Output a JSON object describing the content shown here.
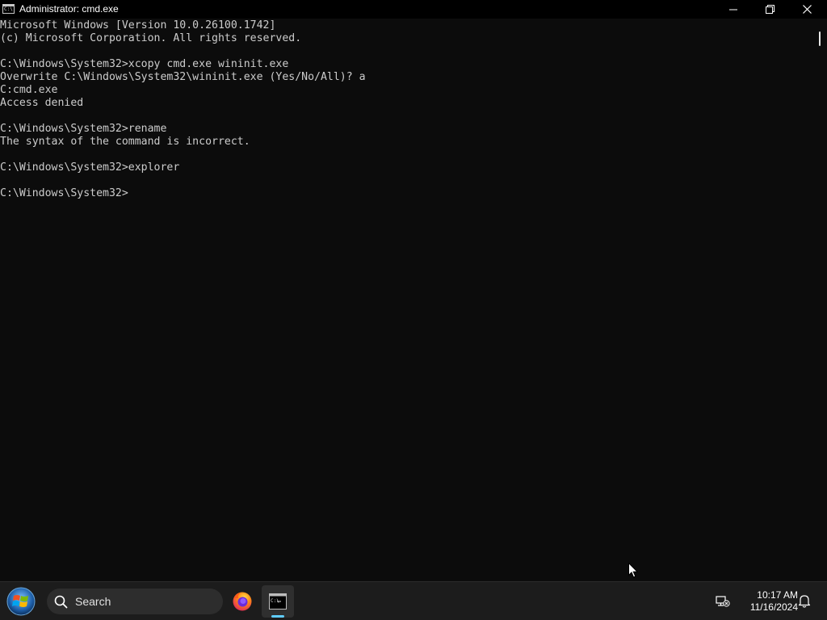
{
  "window": {
    "title": "Administrator: cmd.exe",
    "app_icon_text": "C:\\"
  },
  "console": {
    "lines": [
      "Microsoft Windows [Version 10.0.26100.1742]",
      "(c) Microsoft Corporation. All rights reserved.",
      "",
      "C:\\Windows\\System32>xcopy cmd.exe wininit.exe",
      "Overwrite C:\\Windows\\System32\\wininit.exe (Yes/No/All)? a",
      "C:cmd.exe",
      "Access denied",
      "",
      "C:\\Windows\\System32>rename",
      "The syntax of the command is incorrect.",
      "",
      "C:\\Windows\\System32>explorer",
      "",
      "C:\\Windows\\System32>"
    ]
  },
  "taskbar": {
    "search_placeholder": "Search",
    "apps": [
      "firefox-icon",
      "cmd-icon"
    ],
    "clock": {
      "time": "10:17 AM",
      "date": "11/16/2024"
    }
  },
  "colors": {
    "console_bg": "#0c0c0c",
    "console_fg": "#cccccc",
    "taskbar_bg": "#1c1c1c",
    "accent": "#60cdff"
  }
}
